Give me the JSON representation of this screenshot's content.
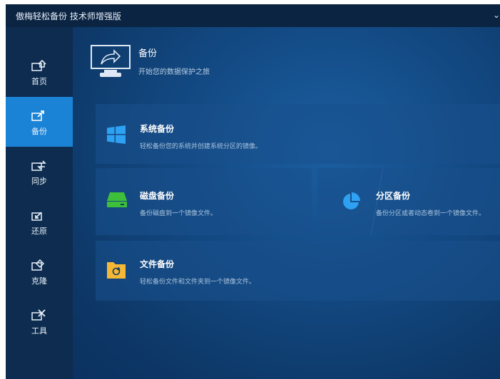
{
  "window": {
    "title": "傲梅轻松备份 技术师增强版"
  },
  "sidebar": {
    "items": [
      {
        "label": "首页",
        "icon": "home-icon",
        "active": false
      },
      {
        "label": "备份",
        "icon": "backup-icon",
        "active": true
      },
      {
        "label": "同步",
        "icon": "sync-icon",
        "active": false
      },
      {
        "label": "还原",
        "icon": "restore-icon",
        "active": false
      },
      {
        "label": "克隆",
        "icon": "clone-icon",
        "active": false
      },
      {
        "label": "工具",
        "icon": "tools-icon",
        "active": false
      }
    ]
  },
  "header": {
    "title": "备份",
    "subtitle": "开始您的数据保护之旅",
    "icon": "backup-monitor-icon"
  },
  "options": {
    "system": {
      "title": "系统备份",
      "desc": "轻松备份您的系统并创建系统分区的镜像。",
      "icon": "windows-icon"
    },
    "disk": {
      "title": "磁盘备份",
      "desc": "备份磁盘到一个镜像文件。",
      "icon": "disk-icon"
    },
    "partition": {
      "title": "分区备份",
      "desc": "备份分区或者动态卷到一个镜像文件。",
      "icon": "pie-chart-icon"
    },
    "file": {
      "title": "文件备份",
      "desc": "轻松备份文件和文件夹到一个镜像文件。",
      "icon": "folder-icon"
    }
  },
  "colors": {
    "accent": "#1a83d6",
    "sidebar": "#0d2c4f",
    "titlebar": "#0b2442"
  }
}
